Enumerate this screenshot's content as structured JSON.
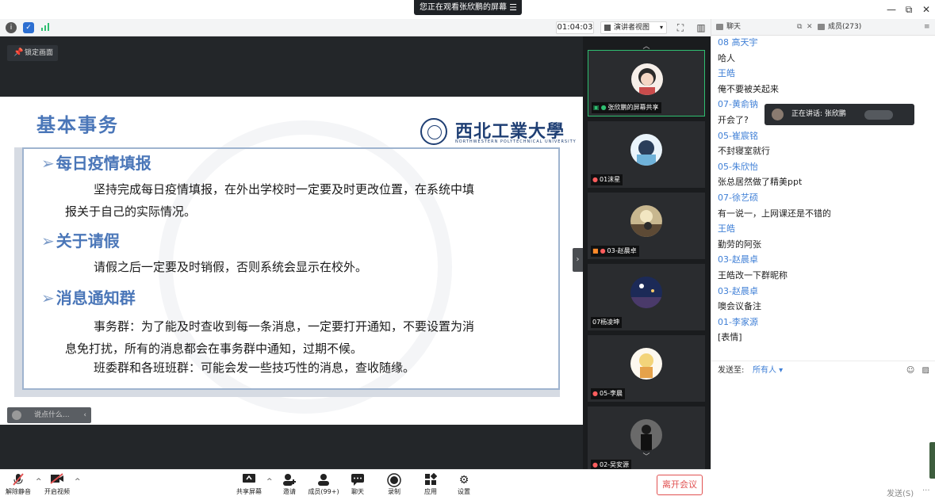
{
  "titlebar": {
    "share_notice": "您正在观看张欣鹏的屏幕",
    "minimize": "—",
    "restore": "⧉",
    "close": "✕"
  },
  "infobar": {
    "timer": "01:04:03",
    "view_mode": "演讲者视图"
  },
  "stage": {
    "lock_label": "锁定画面",
    "comment_placeholder": "说点什么...",
    "collapse_glyph": "›"
  },
  "slide": {
    "title": "基本事务",
    "logo_cn": "西北工業大學",
    "logo_en": "NORTHWESTERN POLYTECHNICAL UNIVERSITY",
    "sections": [
      {
        "heading": "每日疫情填报",
        "lines": [
          "坚持完成每日疫情填报，在外出学校时一定要及时更改位置，在系统中填",
          "报关于自己的实际情况。"
        ]
      },
      {
        "heading": "关于请假",
        "lines": [
          "请假之后一定要及时销假，否则系统会显示在校外。"
        ]
      },
      {
        "heading": "消息通知群",
        "lines": [
          "事务群：为了能及时查收到每一条消息，一定要打开通知，不要设置为消",
          "息免打扰，所有的消息都会在事务群中通知，过期不候。",
          "班委群和各班班群：可能会发一些技巧性的消息，查收随缘。"
        ]
      }
    ]
  },
  "videos": [
    {
      "label": "张欣鹏的屏幕共享",
      "active": true
    },
    {
      "label": "01沫星",
      "active": false
    },
    {
      "label": "03-赵晨卓",
      "active": false
    },
    {
      "label": "07杨凌坤",
      "active": false
    },
    {
      "label": "05-李晨",
      "active": false
    },
    {
      "label": "02-吴安源",
      "active": false
    }
  ],
  "panel": {
    "chat_tab": "聊天",
    "members_tab": "成员(273)",
    "speaker_toast": "正在讲话: 张欣鹏",
    "send_to_label": "发送至:",
    "send_to_target": "所有人",
    "send_button": "发送(S)",
    "send_more": "···"
  },
  "chat": [
    {
      "type": "name",
      "text": "08 高天宇"
    },
    {
      "type": "text",
      "text": "哈人"
    },
    {
      "type": "name",
      "text": "王皓"
    },
    {
      "type": "text",
      "text": "俺不要被关起来"
    },
    {
      "type": "name",
      "text": "07-黄俞钠"
    },
    {
      "type": "text",
      "text": "开会了?"
    },
    {
      "type": "name",
      "text": "05-崔宸铭"
    },
    {
      "type": "text",
      "text": "不封寝室就行"
    },
    {
      "type": "name",
      "text": "05-朱欣怡"
    },
    {
      "type": "text",
      "text": "张总居然做了精美ppt"
    },
    {
      "type": "name",
      "text": "07-徐艺硕"
    },
    {
      "type": "text",
      "text": "有一说一，上网课还是不错的"
    },
    {
      "type": "name",
      "text": "王皓"
    },
    {
      "type": "text",
      "text": "勤劳的阿张"
    },
    {
      "type": "name",
      "text": "03-赵晨卓"
    },
    {
      "type": "text",
      "text": "王皓改一下群昵称"
    },
    {
      "type": "name",
      "text": "03-赵晨卓"
    },
    {
      "type": "text",
      "text": "噢会议备注"
    },
    {
      "type": "name",
      "text": "01-李家源"
    },
    {
      "type": "text",
      "text": "[表情]"
    }
  ],
  "toolbar": {
    "unmute": "解除静音",
    "start_video": "开启视频",
    "share_screen": "共享屏幕",
    "invite": "邀请",
    "members": "成员(99+)",
    "chat": "聊天",
    "record": "录制",
    "apps": "应用",
    "settings": "设置",
    "leave": "离开会议"
  },
  "colors": {
    "accent_blue": "#4a76b8",
    "chat_name_blue": "#3f7fd6",
    "leave_red": "#e15151",
    "active_green": "#2fbf71"
  }
}
